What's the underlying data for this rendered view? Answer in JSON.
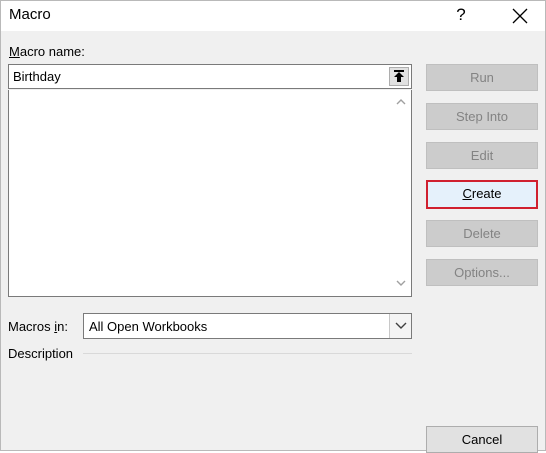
{
  "window": {
    "title": "Macro",
    "help_label": "?"
  },
  "macro_name": {
    "label_prefix": "M",
    "label_rest": "acro name:",
    "value": "Birthday"
  },
  "macros_list": {
    "items": []
  },
  "macros_in": {
    "label_prefix": "Macros ",
    "label_access": "i",
    "label_rest": "n:",
    "selected": "All Open Workbooks"
  },
  "description": {
    "label": "Description"
  },
  "buttons": {
    "run": "Run",
    "step_into": "Step Into",
    "edit": "Edit",
    "create_access": "C",
    "create_rest": "reate",
    "delete": "Delete",
    "options": "Options...",
    "cancel": "Cancel"
  },
  "colors": {
    "focus_border": "#d0202f",
    "focus_fill": "#e5f1fb",
    "disabled_text": "#838383"
  },
  "icons": {
    "close": "close-icon",
    "upload": "upload-arrow-icon",
    "scroll_up": "chevron-up-icon",
    "scroll_down": "chevron-down-icon",
    "dropdown": "chevron-down-icon"
  }
}
